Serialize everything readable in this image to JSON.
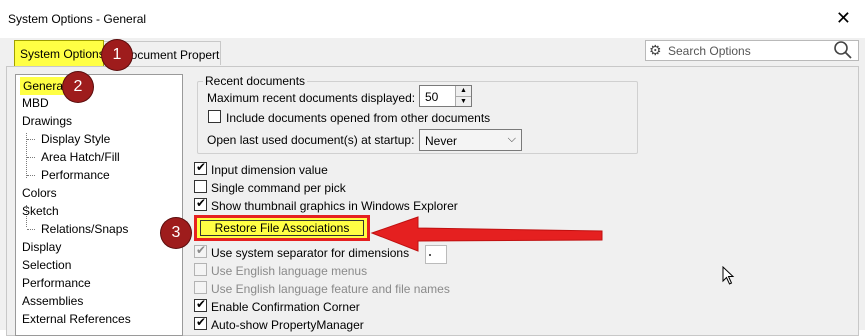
{
  "window": {
    "title": "System Options - General"
  },
  "tabs": [
    {
      "label": "System Options",
      "active": true
    },
    {
      "label": "Document Properties",
      "active": false
    }
  ],
  "search": {
    "placeholder": "Search Options"
  },
  "tree": {
    "items": [
      {
        "label": "General",
        "level": 0,
        "selected": true
      },
      {
        "label": "MBD",
        "level": 0
      },
      {
        "label": "Drawings",
        "level": 0
      },
      {
        "label": "Display Style",
        "level": 1
      },
      {
        "label": "Area Hatch/Fill",
        "level": 1
      },
      {
        "label": "Performance",
        "level": 1
      },
      {
        "label": "Colors",
        "level": 0
      },
      {
        "label": "Sketch",
        "level": 0
      },
      {
        "label": "Relations/Snaps",
        "level": 1
      },
      {
        "label": "Display",
        "level": 0
      },
      {
        "label": "Selection",
        "level": 0
      },
      {
        "label": "Performance",
        "level": 0
      },
      {
        "label": "Assemblies",
        "level": 0
      },
      {
        "label": "External References",
        "level": 0
      }
    ]
  },
  "recent_documents": {
    "legend": "Recent documents",
    "max_label": "Maximum recent documents displayed:",
    "max_value": "50",
    "include_other_label": "Include documents opened from other documents",
    "include_other_checked": false,
    "open_last_label": "Open last used document(s) at startup:",
    "open_last_value": "Never"
  },
  "options": [
    {
      "label": "Input dimension value",
      "checked": true,
      "enabled": true
    },
    {
      "label": "Single command per pick",
      "checked": false,
      "enabled": true
    },
    {
      "label": "Show thumbnail graphics in Windows Explorer",
      "checked": true,
      "enabled": true
    }
  ],
  "restore_button": {
    "label": "Restore File Associations"
  },
  "options_after": [
    {
      "label": "Use system separator for dimensions",
      "checked": true,
      "enabled": false
    },
    {
      "label": "Use English language menus",
      "checked": false,
      "enabled": false
    },
    {
      "label": "Use English language feature and file names",
      "checked": false,
      "enabled": false
    },
    {
      "label": "Enable Confirmation Corner",
      "checked": true,
      "enabled": true
    },
    {
      "label": "Auto-show PropertyManager",
      "checked": true,
      "enabled": true
    }
  ],
  "annotations": {
    "badges": [
      "1",
      "2",
      "3"
    ],
    "badge_color": "#9e1c1c",
    "highlight_color": "#ffff44",
    "arrow_color": "#e52020"
  }
}
